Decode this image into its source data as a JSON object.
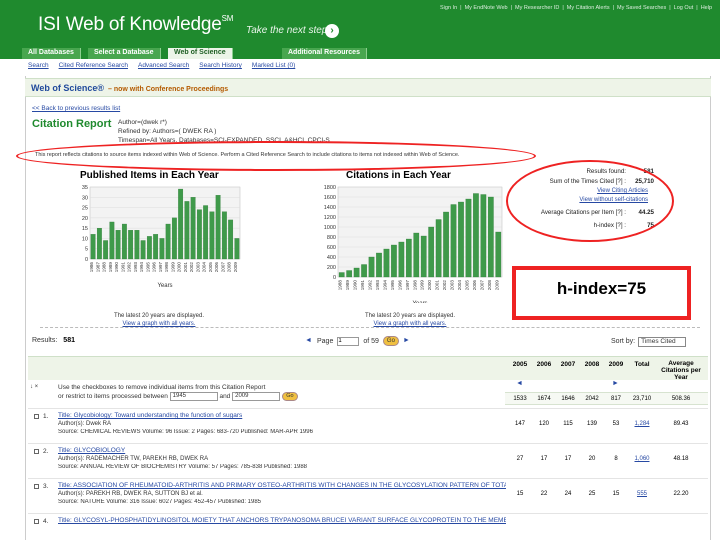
{
  "header": {
    "logo": "ISI Web of Knowledge",
    "logo_sup": "SM",
    "tagline": "Take the next step",
    "top_links": [
      "Sign In",
      "My EndNote Web",
      "My Researcher ID",
      "My Citation Alerts",
      "My Saved Searches",
      "Log Out",
      "Help"
    ]
  },
  "tabs": [
    "All Databases",
    "Select a Database",
    "Web of Science",
    "Additional Resources"
  ],
  "subnav": [
    "Search",
    "Cited Reference Search",
    "Advanced Search",
    "Search History",
    "Marked List (0)"
  ],
  "wos": {
    "title": "Web of Science®",
    "subtitle": "– now with Conference Proceedings"
  },
  "back_link": "<< Back to previous results list",
  "citation_report": {
    "title": "Citation Report",
    "meta1": "Author=(dwek r*)",
    "meta2": "Refined by: Authors=( DWEK RA )",
    "meta3": "Timespan=All Years. Databases=SCI-EXPANDED, SSCI, A&HCI, CPCI-S",
    "note": "This report reflects citations to source items indexed within Web of Science. Perform a Cited Reference Search to include citations to items not indexed within Web of Science."
  },
  "chart_data": [
    {
      "type": "bar",
      "title": "Published Items in Each Year",
      "xlabel": "Years",
      "ylabel": "",
      "ylim": [
        0,
        35
      ],
      "yticks": [
        0,
        5,
        10,
        15,
        20,
        25,
        30,
        35
      ],
      "categories": [
        "1986",
        "1987",
        "1988",
        "1989",
        "1990",
        "1991",
        "1992",
        "1993",
        "1994",
        "1995",
        "1996",
        "1997",
        "1998",
        "1999",
        "2000",
        "2001",
        "2002",
        "2003",
        "2004",
        "2005",
        "2006",
        "2007",
        "2008",
        "2009"
      ],
      "values": [
        12,
        15,
        9,
        18,
        14,
        17,
        14,
        14,
        9,
        11,
        12,
        10,
        17,
        20,
        34,
        28,
        30,
        24,
        26,
        23,
        31,
        23,
        19,
        10
      ]
    },
    {
      "type": "bar",
      "title": "Citations in Each Year",
      "xlabel": "Years",
      "ylabel": "",
      "ylim": [
        0,
        1800
      ],
      "yticks": [
        0,
        200,
        400,
        600,
        800,
        1000,
        1200,
        1400,
        1600,
        1800
      ],
      "categories": [
        "1988",
        "1989",
        "1990",
        "1991",
        "1992",
        "1993",
        "1994",
        "1995",
        "1996",
        "1997",
        "1998",
        "1999",
        "2000",
        "2001",
        "2002",
        "2003",
        "2004",
        "2005",
        "2006",
        "2007",
        "2008",
        "2009"
      ],
      "values": [
        90,
        130,
        180,
        250,
        400,
        480,
        560,
        640,
        700,
        760,
        880,
        820,
        1000,
        1150,
        1300,
        1450,
        1500,
        1560,
        1670,
        1650,
        1600,
        900
      ]
    }
  ],
  "captions": {
    "chart1_line1": "The latest 20 years are displayed.",
    "chart1_link": "View a graph with all years.",
    "chart2_line1": "The latest 20 years are displayed.",
    "chart2_link": "View a graph with all years."
  },
  "stats": {
    "results_found_label": "Results found:",
    "results_found": "581",
    "sum_times_cited_label": "Sum of the Times Cited [?] :",
    "sum_times_cited": "25,710",
    "view_citing": "View Citing Articles",
    "view_without_self": "View without self-citations",
    "avg_citations_label": "Average Citations per Item [?] :",
    "avg_citations": "44.25",
    "h_index_label": "h-index [?] :",
    "h_index": "75"
  },
  "callout": "h-index=75",
  "results_bar": {
    "label": "Results:",
    "count": "581",
    "page_label": "Page",
    "page_value": "1",
    "page_of": "of 59",
    "go": "Go",
    "sort_label": "Sort by:",
    "sort_value": "Times Cited"
  },
  "table": {
    "years": [
      "2005",
      "2006",
      "2007",
      "2008",
      "2009"
    ],
    "total_label": "Total",
    "avg_label": "Average Citations per Year",
    "summary": [
      "1533",
      "1674",
      "1646",
      "2042",
      "817",
      "23,710",
      "508.36"
    ],
    "instr_line1": "Use the checkboxes to remove individual items from this Citation Report",
    "instr_line2": "or restrict to items processed between",
    "instr_from": "1945",
    "instr_and": "and",
    "instr_to": "2009",
    "instr_go": "Go"
  },
  "records": [
    {
      "num": "1.",
      "title": "Title: Glycobiology: Toward understanding the function of sugars",
      "author": "Author(s): Dwek RA",
      "source": "Source: CHEMICAL REVIEWS   Volume: 96   Issue: 2   Pages: 683-720   Published: MAR-APR 1996",
      "cells": [
        "147",
        "120",
        "115",
        "139",
        "53"
      ],
      "total": "1,284",
      "avg": "89.43"
    },
    {
      "num": "2.",
      "title": "Title: GLYCOBIOLOGY",
      "author": "Author(s): RADEMACHER TW, PAREKH RB, DWEK RA",
      "source": "Source: ANNUAL REVIEW OF BIOCHEMISTRY   Volume: 57   Pages: 785-838   Published: 1988",
      "cells": [
        "27",
        "17",
        "17",
        "20",
        "8"
      ],
      "total": "1,060",
      "avg": "48.18"
    },
    {
      "num": "3.",
      "title": "Title: ASSOCIATION OF RHEUMATOID-ARTHRITIS AND PRIMARY OSTEO-ARTHRITIS WITH CHANGES IN THE GLYCOSYLATION PATTERN OF TOTAL SERUM IGG",
      "author": "Author(s): PAREKH RB, DWEK RA, SUTTON BJ et al.",
      "source": "Source: NATURE   Volume: 316   Issue: 6027   Pages: 452-457   Published: 1985",
      "cells": [
        "15",
        "22",
        "24",
        "25",
        "15"
      ],
      "total": "555",
      "avg": "22.20"
    },
    {
      "num": "4.",
      "title": "Title: GLYCOSYL-PHOSPHATIDYLINOSITOL MOIETY THAT ANCHORS TRYPANOSOMA BRUCEI VARIANT SURFACE GLYCOPROTEIN TO THE MEMBRANE",
      "author": "",
      "source": "",
      "cells": [
        "",
        "",
        "",
        "",
        ""
      ],
      "total": "",
      "avg": ""
    }
  ]
}
